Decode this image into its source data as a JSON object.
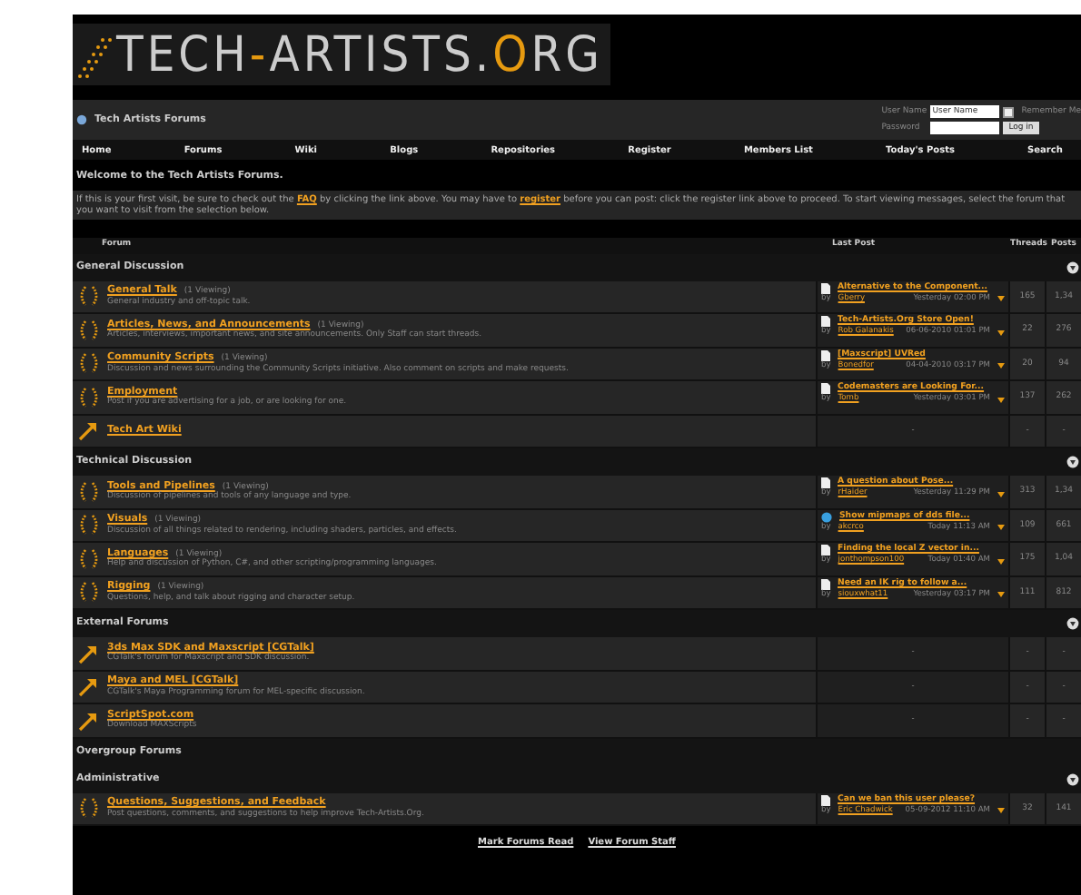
{
  "logo": {
    "parts": [
      {
        "text": "TECH",
        "kind": "plain"
      },
      {
        "text": "-",
        "kind": "accent"
      },
      {
        "text": "ARTISTS",
        "kind": "plain"
      },
      {
        "text": ".",
        "kind": "plain"
      },
      {
        "text": "O",
        "kind": "accent"
      },
      {
        "text": "RG",
        "kind": "plain"
      }
    ]
  },
  "title_bar": {
    "title": "Tech Artists Forums"
  },
  "login": {
    "username_label": "User Name",
    "username_value": "User Name",
    "remember_label": "Remember Me",
    "remember_checked": false,
    "password_label": "Password",
    "button": "Log in"
  },
  "nav": [
    "Home",
    "Forums",
    "Wiki",
    "Blogs",
    "Repositories",
    "Register",
    "Members List",
    "Today's Posts",
    "Search"
  ],
  "welcome": {
    "heading": "Welcome to the Tech Artists Forums.",
    "parts": [
      {
        "text": "If this is your first visit, be sure to check out the ",
        "kind": "text"
      },
      {
        "text": "FAQ",
        "kind": "link"
      },
      {
        "text": " by clicking the link above. You may have to ",
        "kind": "text"
      },
      {
        "text": "register",
        "kind": "link"
      },
      {
        "text": " before you can post: click the register link above to proceed. To start viewing messages, select the forum that you want to visit from the selection below.",
        "kind": "text"
      }
    ]
  },
  "table": {
    "columns": [
      "Forum",
      "Last Post",
      "Threads",
      "Posts"
    ],
    "sections": [
      {
        "title": "General Discussion",
        "collapsible": true,
        "forums": [
          {
            "kind": "forum",
            "title": "General Talk",
            "viewing": "(1 Viewing)",
            "description": "General industry and off-topic talk.",
            "last_post": {
              "kind": "page",
              "title": "Alternative to the Component...",
              "by": "by",
              "author": "Gberry",
              "time": "Yesterday 02:00 PM"
            },
            "threads": "165",
            "posts": "1,34"
          },
          {
            "kind": "forum",
            "title": "Articles, News, and Announcements",
            "viewing": "(1 Viewing)",
            "description": "Articles, interviews, important news, and site announcements. Only Staff can start threads.",
            "last_post": {
              "kind": "page",
              "title": "Tech-Artists.Org Store Open!",
              "by": "by",
              "author": "Rob Galanakis",
              "time": "06-06-2010 01:01 PM"
            },
            "threads": "22",
            "posts": "276"
          },
          {
            "kind": "forum",
            "title": "Community Scripts",
            "viewing": "(1 Viewing)",
            "description": "Discussion and news surrounding the Community Scripts initiative. Also comment on scripts and make requests.",
            "last_post": {
              "kind": "page",
              "title": "[Maxscript] UVRed",
              "by": "by",
              "author": "Bonedfor",
              "time": "04-04-2010 03:17 PM"
            },
            "threads": "20",
            "posts": "94"
          },
          {
            "kind": "forum",
            "title": "Employment",
            "description": "Post if you are advertising for a job, or are looking for one.",
            "last_post": {
              "kind": "page",
              "title": "Codemasters are Looking For...",
              "by": "by",
              "author": "Tomb",
              "time": "Yesterday 03:01 PM"
            },
            "threads": "137",
            "posts": "262"
          },
          {
            "kind": "link",
            "title": "Tech Art Wiki",
            "last_post_text": "-",
            "threads": "-",
            "posts": "-"
          }
        ]
      },
      {
        "title": "Technical Discussion",
        "collapsible": true,
        "forums": [
          {
            "kind": "forum",
            "title": "Tools and Pipelines",
            "viewing": "(1 Viewing)",
            "description": "Discussion of pipelines and tools of any language and type.",
            "last_post": {
              "kind": "page",
              "title": "A question about Pose...",
              "by": "by",
              "author": "rHaider",
              "time": "Yesterday 11:29 PM"
            },
            "threads": "313",
            "posts": "1,34"
          },
          {
            "kind": "forum",
            "title": "Visuals",
            "viewing": "(1 Viewing)",
            "description": "Discussion of all things related to rendering, including shaders, particles, and effects.",
            "last_post": {
              "kind": "question",
              "title": "Show mipmaps of dds file...",
              "by": "by",
              "author": "akcrco",
              "time": "Today 11:13 AM"
            },
            "threads": "109",
            "posts": "661"
          },
          {
            "kind": "forum",
            "title": "Languages",
            "viewing": "(1 Viewing)",
            "description": "Help and discussion of Python, C#, and other scripting/programming languages.",
            "last_post": {
              "kind": "page",
              "title": "Finding the local Z vector in...",
              "by": "by",
              "author": "jonthompson100",
              "time": "Today 01:40 AM"
            },
            "threads": "175",
            "posts": "1,04"
          },
          {
            "kind": "forum",
            "title": "Rigging",
            "viewing": "(1 Viewing)",
            "description": "Questions, help, and talk about rigging and character setup.",
            "last_post": {
              "kind": "page",
              "title": "Need an IK rig to follow a...",
              "by": "by",
              "author": "siouxwhat11",
              "time": "Yesterday 03:17 PM"
            },
            "threads": "111",
            "posts": "812"
          }
        ]
      },
      {
        "title": "External Forums",
        "collapsible": true,
        "forums": [
          {
            "kind": "link",
            "title": "3ds Max SDK and Maxscript [CGTalk]",
            "description": "CGTalk's forum for Maxscript and SDK discussion.",
            "last_post_text": "-",
            "threads": "-",
            "posts": "-"
          },
          {
            "kind": "link",
            "title": "Maya and MEL [CGTalk]",
            "description": "CGTalk's Maya Programming forum for MEL-specific discussion.",
            "last_post_text": "-",
            "threads": "-",
            "posts": "-"
          },
          {
            "kind": "link",
            "title": "ScriptSpot.com",
            "description": "Download MAXScripts",
            "last_post_text": "-",
            "threads": "-",
            "posts": "-"
          }
        ]
      },
      {
        "title": "Overgroup Forums",
        "collapsible": false
      },
      {
        "title": "Administrative",
        "collapsible": true,
        "forums": [
          {
            "kind": "forum",
            "title": "Questions, Suggestions, and Feedback",
            "description": "Post questions, comments, and suggestions to help improve Tech-Artists.Org.",
            "last_post": {
              "kind": "page",
              "title": "Can we ban this user please?",
              "by": "by",
              "author": "Eric Chadwick",
              "time": "05-09-2012 11:10 AM"
            },
            "threads": "32",
            "posts": "141"
          }
        ]
      }
    ]
  },
  "footer_links": [
    "Mark Forums Read",
    "View Forum Staff"
  ]
}
